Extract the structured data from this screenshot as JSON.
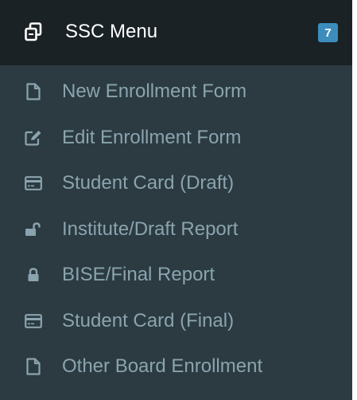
{
  "colors": {
    "sidebar_bg": "#2c3b41",
    "header_bg": "#1a2226",
    "header_text": "#ffffff",
    "item_text": "#8aa4af",
    "badge_bg": "#3c8dbc"
  },
  "header": {
    "icon": "copy-icon",
    "title": "SSC Menu",
    "badge": "7"
  },
  "items": [
    {
      "label": "New Enrollment Form",
      "icon": "file-icon"
    },
    {
      "label": "Edit Enrollment Form",
      "icon": "edit-icon"
    },
    {
      "label": "Student Card (Draft)",
      "icon": "credit-card-icon"
    },
    {
      "label": "Institute/Draft Report",
      "icon": "unlock-icon"
    },
    {
      "label": "BISE/Final Report",
      "icon": "lock-icon"
    },
    {
      "label": "Student Card (Final)",
      "icon": "credit-card-icon"
    },
    {
      "label": "Other Board Enrollment",
      "icon": "file-icon"
    }
  ]
}
